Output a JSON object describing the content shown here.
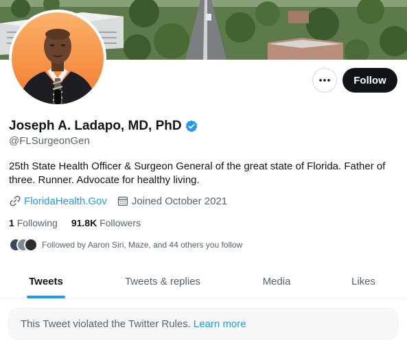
{
  "profile": {
    "display_name": "Joseph A. Ladapo, MD, PhD",
    "handle": "@FLSurgeonGen",
    "bio": "25th State Health Officer & Surgeon General of the great state of Florida. Father of three. Runner. Advocate for healthy living.",
    "website": "FloridaHealth.Gov",
    "joined": "Joined October 2021",
    "verified": true
  },
  "actions": {
    "follow_label": "Follow",
    "more_icon": "more-horizontal-icon"
  },
  "stats": {
    "following_count": "1",
    "following_label": "Following",
    "followers_count": "91.8K",
    "followers_label": "Followers"
  },
  "followed_by": {
    "text": "Followed by Aaron Siri, Maze, and 44 others you follow"
  },
  "tabs": [
    {
      "label": "Tweets",
      "active": true
    },
    {
      "label": "Tweets & replies",
      "active": false
    },
    {
      "label": "Media",
      "active": false
    },
    {
      "label": "Likes",
      "active": false
    }
  ],
  "notice": {
    "text": "This Tweet violated the Twitter Rules.",
    "link": "Learn more"
  },
  "colors": {
    "accent": "#1d9bf0",
    "text_primary": "#0f1419",
    "text_secondary": "#536471",
    "follow_button_bg": "#0f1419",
    "avatar_bg": "#f59a4a"
  }
}
